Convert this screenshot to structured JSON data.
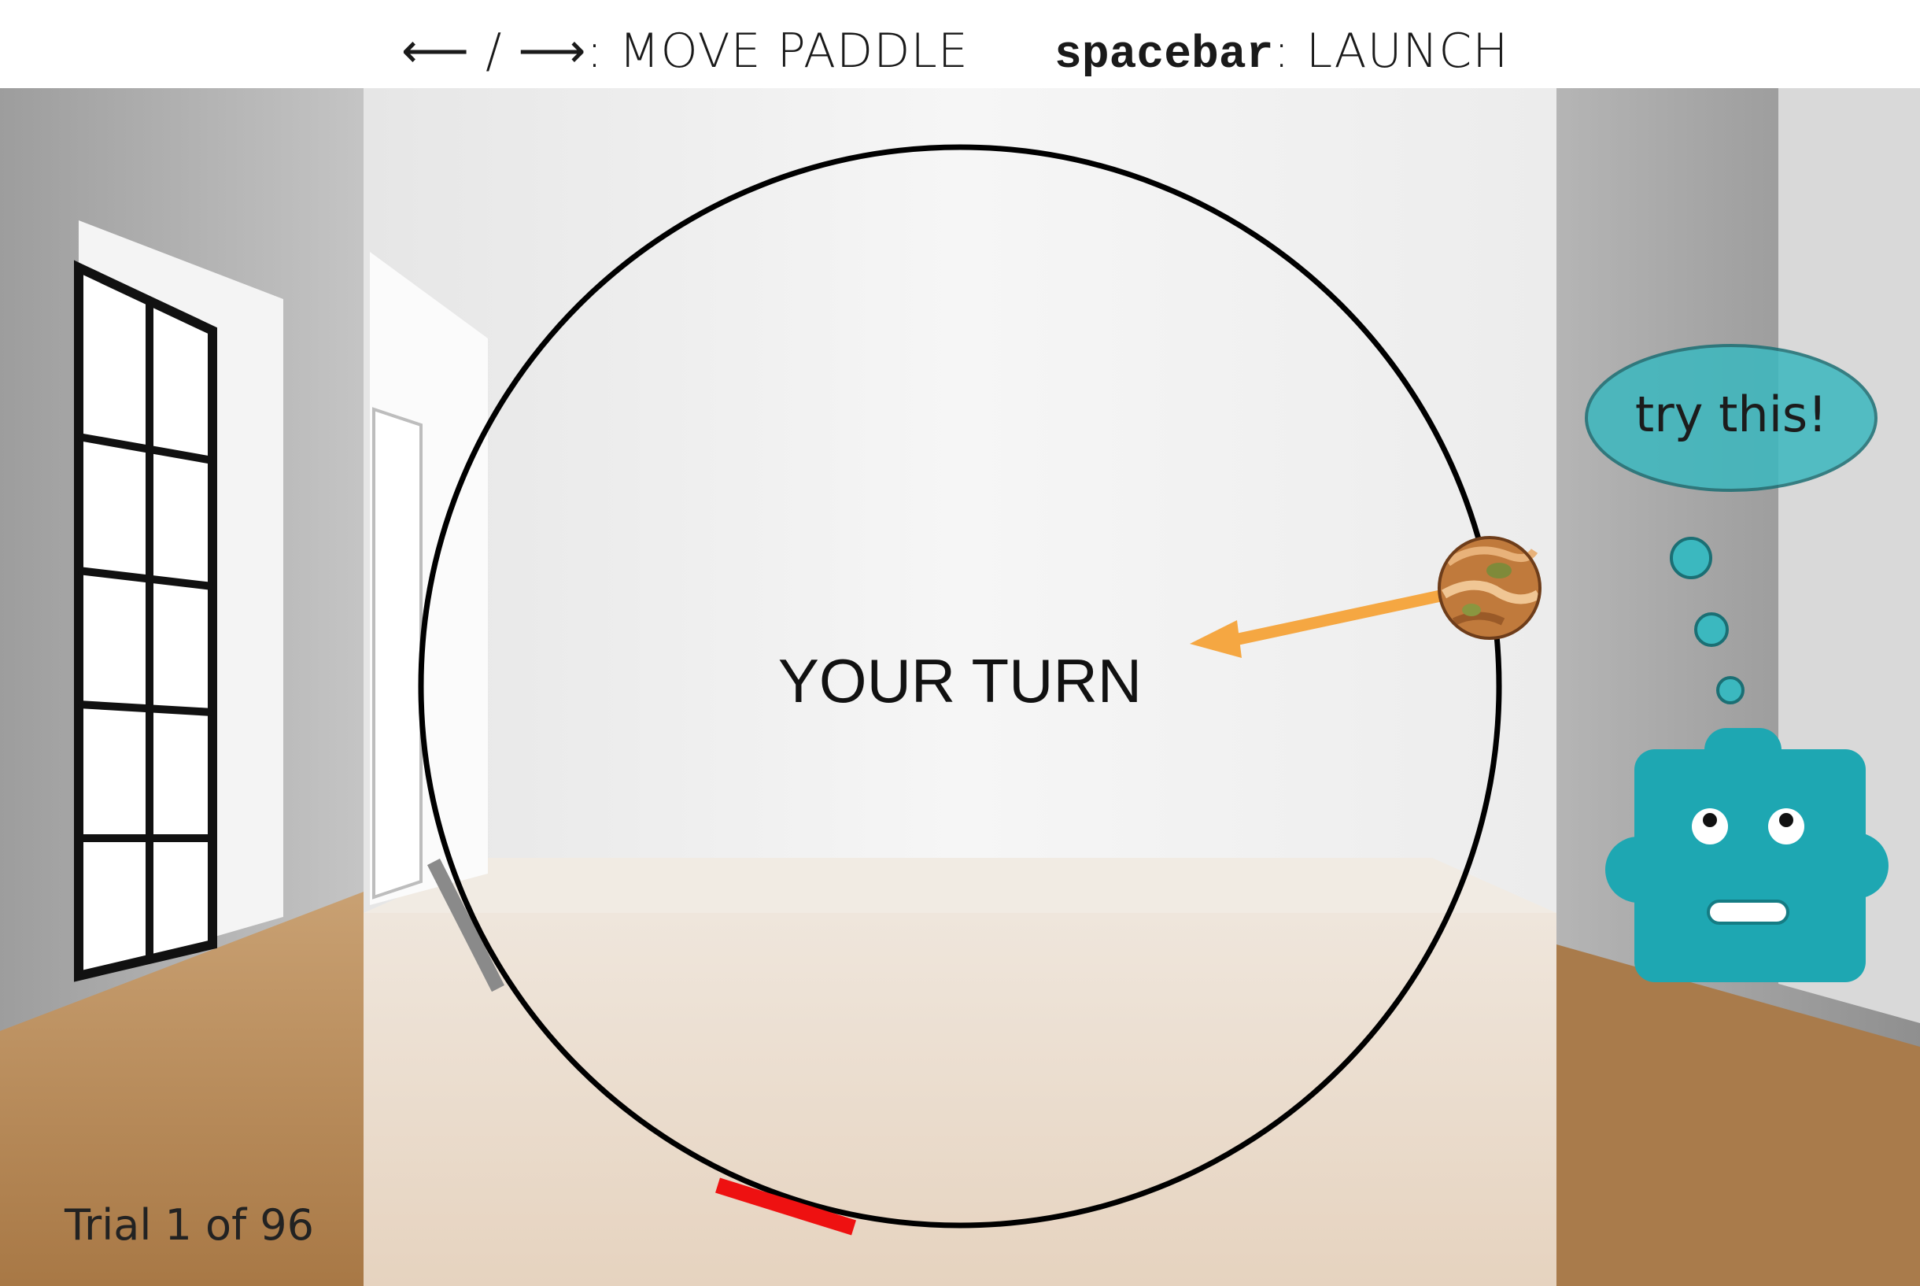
{
  "header": {
    "move_keys": "⟵ / ⟶",
    "move_label": ": MOVE PADDLE",
    "launch_key": "spacebar",
    "launch_label": ": LAUNCH"
  },
  "game": {
    "status_text": "YOUR TURN",
    "trial_text": "Trial 1 of 96",
    "paddle_color": "#8a8a8a",
    "target_color": "#ee1111",
    "arrow_color": "#f5a742",
    "ring_color": "#000000"
  },
  "robot": {
    "speech_text": "try this!",
    "color": "#1ea7b2",
    "bubble_color": "#3bb8bf"
  }
}
